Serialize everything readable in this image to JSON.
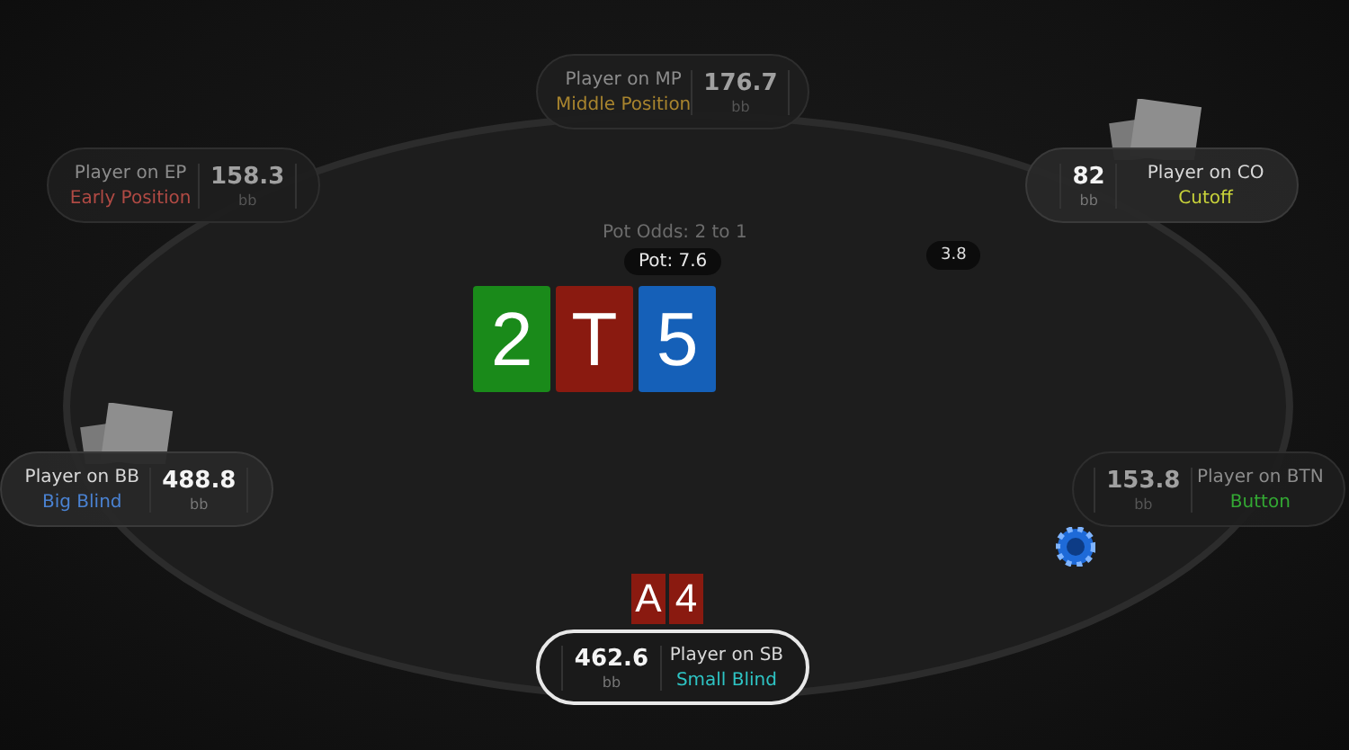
{
  "pot_odds": "Pot Odds: 2 to 1",
  "pot": "Pot: 7.6",
  "board": [
    {
      "rank": "2",
      "color": "#1a8a1a"
    },
    {
      "rank": "T",
      "color": "#8a1a10"
    },
    {
      "rank": "5",
      "color": "#1560b8"
    }
  ],
  "seats": [
    {
      "player": "Player on MP",
      "position": "Middle Position",
      "color": "#a8842e",
      "stack": "176.7",
      "unit": "bb",
      "folded": true,
      "selected": false,
      "has_cards": false
    },
    {
      "player": "Player on EP",
      "position": "Early Position",
      "color": "#b04a44",
      "stack": "158.3",
      "unit": "bb",
      "folded": true,
      "selected": false,
      "has_cards": false
    },
    {
      "player": "Player on CO",
      "position": "Cutoff",
      "color": "#c8d23a",
      "stack": "82",
      "unit": "bb",
      "folded": false,
      "selected": false,
      "has_cards": true
    },
    {
      "player": "Player on BB",
      "position": "Big Blind",
      "color": "#4a82d2",
      "stack": "488.8",
      "unit": "bb",
      "folded": false,
      "selected": false,
      "has_cards": true
    },
    {
      "player": "Player on BTN",
      "position": "Button",
      "color": "#33a833",
      "stack": "153.8",
      "unit": "bb",
      "folded": true,
      "selected": false,
      "has_cards": false
    },
    {
      "player": "Player on SB",
      "position": "Small Blind",
      "color": "#2ec4c4",
      "stack": "462.6",
      "unit": "bb",
      "folded": false,
      "selected": true,
      "has_cards": false
    }
  ],
  "bets": [
    {
      "amount": "3.8"
    }
  ],
  "hero_cards": [
    {
      "rank": "A",
      "color": "#8a1a10"
    },
    {
      "rank": "4",
      "color": "#8a1a10"
    }
  ]
}
